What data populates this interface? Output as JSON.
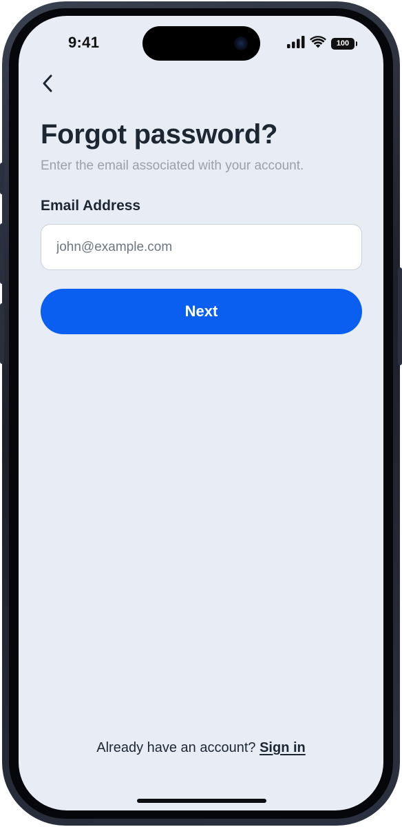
{
  "status_bar": {
    "time": "9:41",
    "battery_level": "100",
    "icons": [
      "signal-icon",
      "wifi-icon",
      "battery-icon"
    ]
  },
  "nav": {
    "back_icon": "chevron-left-icon"
  },
  "header": {
    "title": "Forgot password?",
    "subtitle": "Enter the email associated with your account."
  },
  "form": {
    "email_label": "Email Address",
    "email_placeholder": "john@example.com",
    "email_value": "",
    "submit_label": "Next"
  },
  "footer": {
    "prompt": "Already have an account?",
    "link_label": "Sign in"
  },
  "colors": {
    "background": "#e7ecf5",
    "primary": "#0a5ff0",
    "text": "#1d2733",
    "muted_text": "#9aa1ab"
  }
}
